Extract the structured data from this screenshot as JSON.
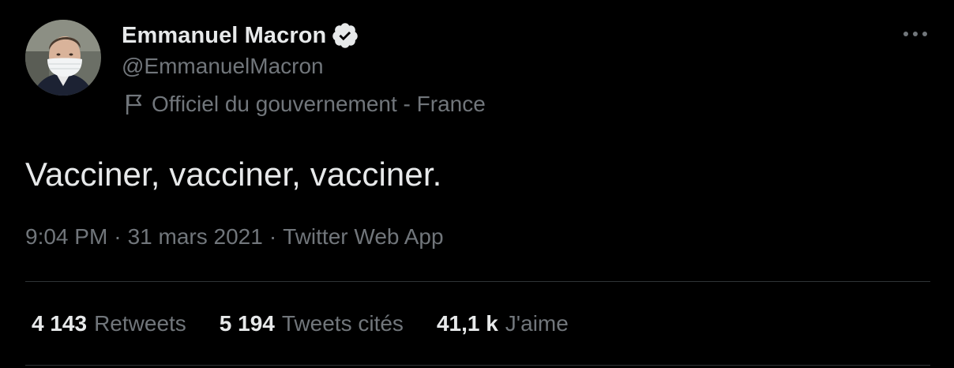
{
  "author": {
    "display_name": "Emmanuel Macron",
    "handle": "@EmmanuelMacron",
    "verified": true,
    "avatar_icon": "profile-photo"
  },
  "affiliation": {
    "icon": "flag-icon",
    "text": "Officiel du gouvernement - France"
  },
  "tweet": {
    "text": "Vacciner, vacciner, vacciner."
  },
  "meta": {
    "time": "9:04 PM",
    "date": "31 mars 2021",
    "source": "Twitter Web App",
    "separator": "·"
  },
  "stats": [
    {
      "value": "4 143",
      "label": "Retweets"
    },
    {
      "value": "5 194",
      "label": "Tweets cités"
    },
    {
      "value": "41,1 k",
      "label": "J'aime"
    }
  ],
  "colors": {
    "background": "#000000",
    "primary_text": "#e7e9ea",
    "secondary_text": "#71767b",
    "divider": "#2f3336",
    "verified_badge": "#e7e9ea"
  }
}
